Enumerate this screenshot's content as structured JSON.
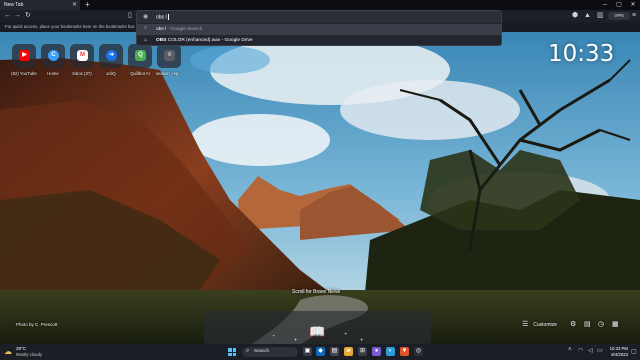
{
  "browser": {
    "tab_title": "New Tab",
    "tab_close_icon": "close-icon",
    "new_tab_icon": "plus-icon",
    "bookmarks_hint": "For quick access, place your bookmarks here on the bookmarks bar.",
    "vpn_label": "VPN"
  },
  "omnibox": {
    "query": "obs l",
    "suggestions": [
      {
        "main": "obs l",
        "sub": " - Google Search",
        "icon": "search-icon",
        "selected": true
      },
      {
        "main": "OBS",
        "sub": " COLOR (enhanced).wav - Google Drive",
        "icon": "drive-icon",
        "selected": false
      }
    ]
  },
  "top_sites": [
    {
      "label": "(92) YouTube",
      "glyph": "▶",
      "color": "#ff0000"
    },
    {
      "label": "Home",
      "glyph": "C",
      "color": "#3aa0ff"
    },
    {
      "label": "Inbox (37)",
      "glyph": "M",
      "color": "#ea4335"
    },
    {
      "label": "xcliQ",
      "glyph": "➜",
      "color": "#1a73e8"
    },
    {
      "label": "Quillbot AI",
      "glyph": "Q",
      "color": "#4caf50"
    },
    {
      "label": "season_rep...",
      "glyph": "≡",
      "color": "#5a5d66"
    }
  ],
  "clock": "10:33",
  "photo_credit": "Photo by C. Prescott",
  "scroll_hint": "Scroll for Brave News",
  "customize_label": "Customize",
  "weather": {
    "temp": "29°C",
    "desc": "Mostly cloudy"
  },
  "taskbar": {
    "search_label": "Search",
    "time": "10:33 PM",
    "date": "8/4/2023"
  },
  "colors": {
    "accent_start": "#4cc2ff",
    "sky_top": "#2f7fb0",
    "cliff": "#8a3a1c"
  }
}
